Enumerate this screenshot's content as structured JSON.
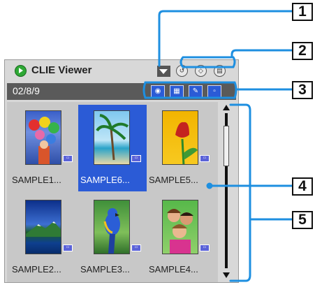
{
  "app": {
    "title": "CLIE Viewer",
    "date": "02/8/9"
  },
  "toolbar": {
    "dropdown_icon": "dropdown-arrow-icon",
    "round_buttons": [
      "rotate-left-icon",
      "rotate-right-icon",
      "trash-icon"
    ],
    "view_buttons": [
      "camera-icon",
      "grid-icon",
      "edit-icon",
      "memo-icon"
    ]
  },
  "thumbnails": [
    {
      "label": "SAMPLE1...",
      "selected": false
    },
    {
      "label": "SAMPLE6...",
      "selected": true
    },
    {
      "label": "SAMPLE5...",
      "selected": false
    },
    {
      "label": "SAMPLE2...",
      "selected": false
    },
    {
      "label": "SAMPLE3...",
      "selected": false
    },
    {
      "label": "SAMPLE4...",
      "selected": false
    }
  ],
  "callouts": [
    "1",
    "2",
    "3",
    "4",
    "5"
  ],
  "colors": {
    "accent": "#2b5bd6",
    "callout_line": "#1e8fe0",
    "app_icon": "#2ea835"
  }
}
